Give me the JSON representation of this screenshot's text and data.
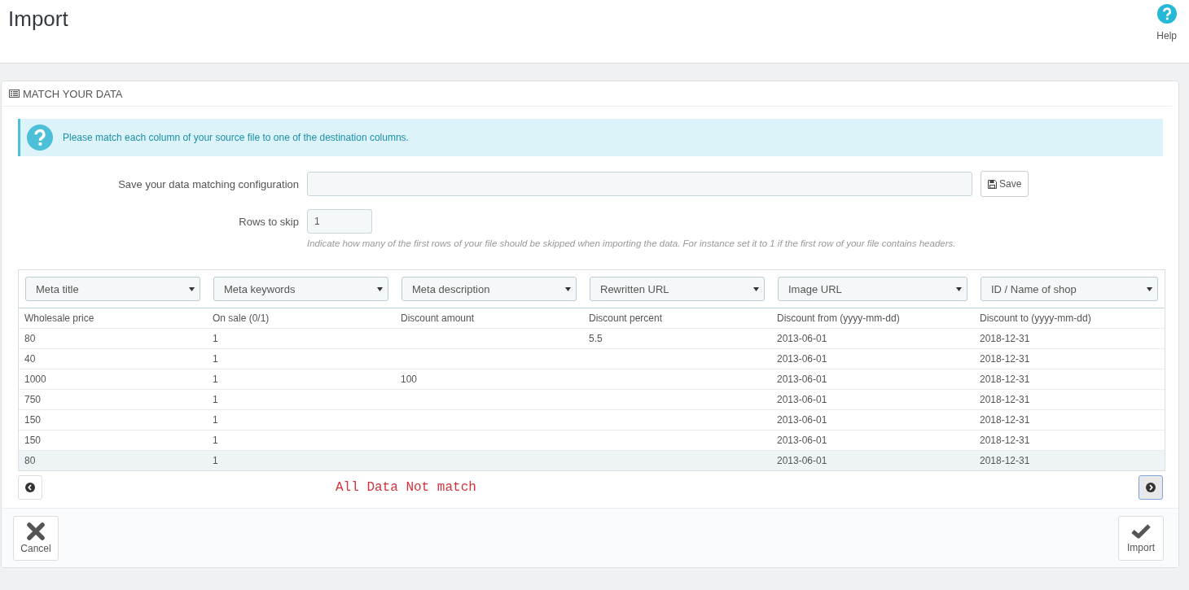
{
  "page": {
    "title": "Import",
    "help_label": "Help"
  },
  "panel": {
    "title": "MATCH YOUR DATA",
    "alert": "Please match each column of your source file to one of the destination columns.",
    "save_config": {
      "label": "Save your data matching configuration",
      "button": "Save"
    },
    "rows_to_skip": {
      "label": "Rows to skip",
      "value": "1",
      "hint": "Indicate how many of the first rows of your file should be skipped when importing the data. For instance set it to 1 if the first row of your file contains headers."
    },
    "table": {
      "selects": [
        "Meta title",
        "Meta keywords",
        "Meta description",
        "Rewritten URL",
        "Image URL",
        "ID / Name of shop"
      ],
      "columns": [
        "Wholesale price",
        "On sale (0/1)",
        "Discount amount",
        "Discount percent",
        "Discount from (yyyy-mm-dd)",
        "Discount to (yyyy-mm-dd)"
      ],
      "rows": [
        {
          "cells": [
            "80",
            "1",
            "",
            "5.5",
            "2013-06-01",
            "2018-12-31"
          ],
          "highlighted": false
        },
        {
          "cells": [
            "40",
            "1",
            "",
            "",
            "2013-06-01",
            "2018-12-31"
          ],
          "highlighted": false
        },
        {
          "cells": [
            "1000",
            "1",
            "100",
            "",
            "2013-06-01",
            "2018-12-31"
          ],
          "highlighted": false
        },
        {
          "cells": [
            "750",
            "1",
            "",
            "",
            "2013-06-01",
            "2018-12-31"
          ],
          "highlighted": false
        },
        {
          "cells": [
            "150",
            "1",
            "",
            "",
            "2013-06-01",
            "2018-12-31"
          ],
          "highlighted": false
        },
        {
          "cells": [
            "150",
            "1",
            "",
            "",
            "2013-06-01",
            "2018-12-31"
          ],
          "highlighted": false
        },
        {
          "cells": [
            "80",
            "1",
            "",
            "",
            "2013-06-01",
            "2018-12-31"
          ],
          "highlighted": true
        }
      ]
    },
    "prev_button": {
      "focused": false
    },
    "next_button": {
      "focused": true
    },
    "note": "All Data Not match",
    "footer": {
      "cancel": "Cancel",
      "import": "Import"
    }
  }
}
